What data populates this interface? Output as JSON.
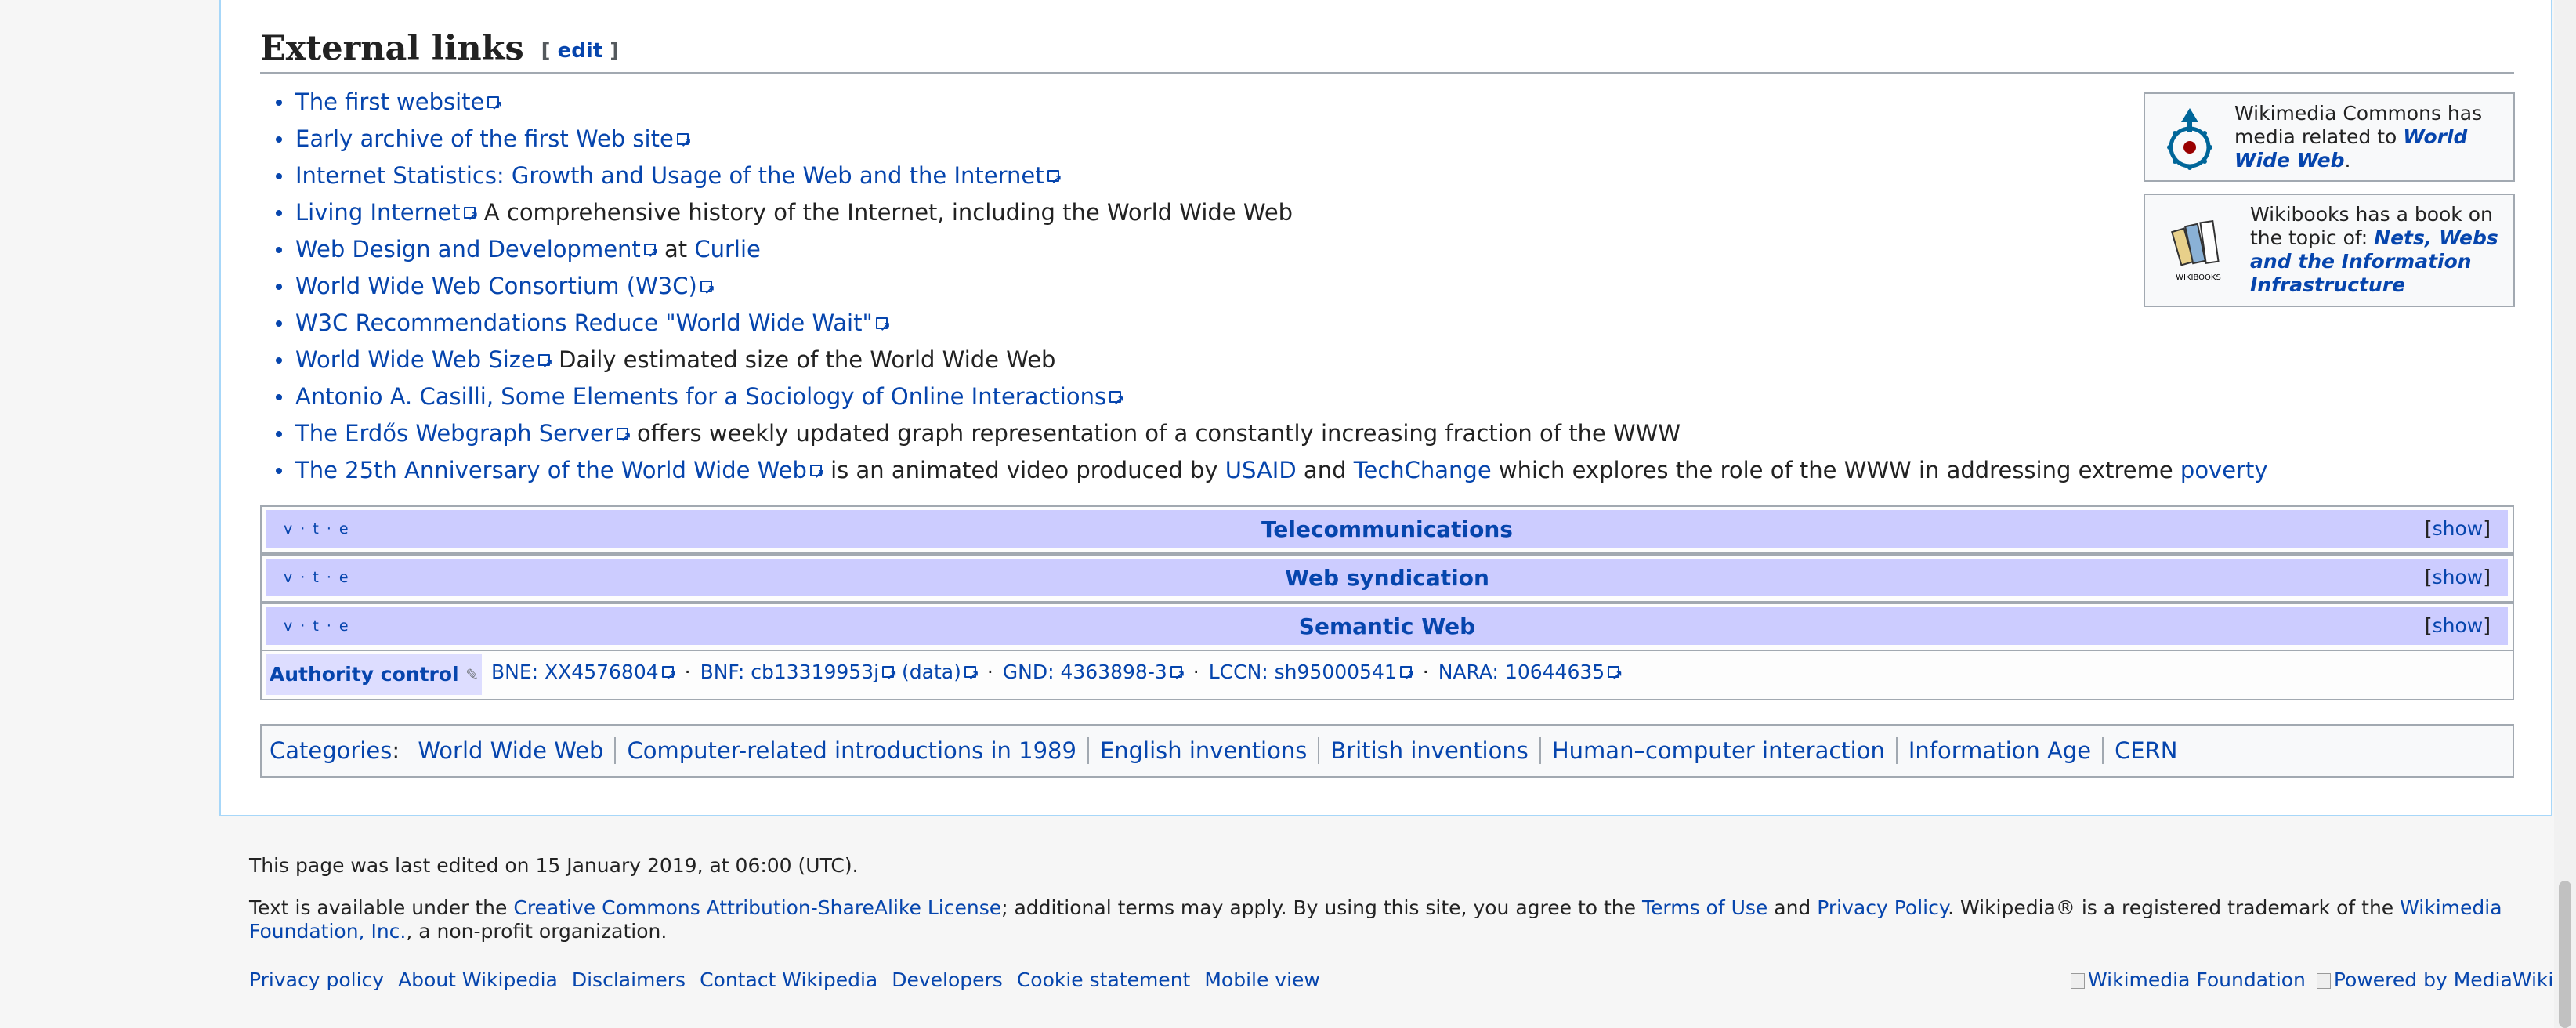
{
  "section": {
    "title": "External links",
    "edit_label": "edit"
  },
  "external_links": [
    {
      "link": "The first website",
      "rest": ""
    },
    {
      "link": "Early archive of the first Web site",
      "rest": ""
    },
    {
      "link": "Internet Statistics: Growth and Usage of the Web and the Internet",
      "rest": ""
    },
    {
      "link": "Living Internet",
      "rest": " A comprehensive history of the Internet, including the World Wide Web"
    },
    {
      "link": "Web Design and Development",
      "rest": " at ",
      "extra_link": "Curlie"
    },
    {
      "link": "World Wide Web Consortium (W3C)",
      "rest": ""
    },
    {
      "link": "W3C Recommendations Reduce \"World Wide Wait\"",
      "rest": ""
    },
    {
      "link": "World Wide Web Size",
      "rest": " Daily estimated size of the World Wide Web"
    },
    {
      "link": "Antonio A. Casilli, Some Elements for a Sociology of Online Interactions",
      "rest": ""
    },
    {
      "link": "The Erdős Webgraph Server",
      "rest": " offers weekly updated graph representation of a constantly increasing fraction of the WWW"
    },
    {
      "link": "The 25th Anniversary of the World Wide Web",
      "rest": " is an animated video produced by ",
      "extra_link": "USAID",
      "rest2": " and ",
      "extra_link2": "TechChange",
      "rest3": " which explores the role of the WWW in addressing extreme ",
      "extra_link3": "poverty"
    }
  ],
  "sister": {
    "commons": {
      "text1": "Wikimedia Commons has media related to ",
      "link": "World Wide Web",
      "text2": "."
    },
    "wikibooks": {
      "text1": "Wikibooks has a book on the topic of: ",
      "link": "Nets, Webs and the Information Infrastructure",
      "logo_text": "WIKIBOOKS"
    }
  },
  "navboxes": [
    {
      "vte": "v · t · e",
      "title": "Telecommunications",
      "toggle": "[show]"
    },
    {
      "vte": "v · t · e",
      "title": "Web syndication",
      "toggle": "[show]"
    },
    {
      "vte": "v · t · e",
      "title": "Semantic Web",
      "toggle": "[show]"
    }
  ],
  "authority": {
    "label": "Authority control",
    "bne_label": "BNE: ",
    "bne": "XX4576804",
    "bnf_label": "BNF: ",
    "bnf": "cb13319953j",
    "bnf_data": "(data)",
    "gnd_label": "GND: ",
    "gnd": "4363898-3",
    "lccn_label": "LCCN: ",
    "lccn": "sh95000541",
    "nara_label": "NARA: ",
    "nara": "10644635"
  },
  "categories": {
    "label": "Categories",
    "items": [
      "World Wide Web",
      "Computer-related introductions in 1989",
      "English inventions",
      "British inventions",
      "Human–computer interaction",
      "Information Age",
      "CERN"
    ]
  },
  "footer": {
    "last_edited": "This page was last edited on 15 January 2019, at 06:00 (UTC).",
    "license_pre": "Text is available under the ",
    "license_link": "Creative Commons Attribution-ShareAlike License",
    "license_mid": "; additional terms may apply. By using this site, you agree to the ",
    "terms_link": "Terms of Use",
    "and": " and ",
    "privacy_link": "Privacy Policy",
    "trademark_pre": ". Wikipedia® is a registered trademark of the ",
    "foundation_link": "Wikimedia Foundation, Inc.",
    "trademark_post": ", a non-profit organization.",
    "places": [
      "Privacy policy",
      "About Wikipedia",
      "Disclaimers",
      "Contact Wikipedia",
      "Developers",
      "Cookie statement",
      "Mobile view"
    ],
    "icons": [
      "Wikimedia Foundation",
      "Powered by MediaWiki"
    ]
  },
  "colors": {
    "link": "#0645ad",
    "navbox_title_bg": "#ccf",
    "authority_head_bg": "#ddf",
    "border": "#a2a9b1"
  }
}
